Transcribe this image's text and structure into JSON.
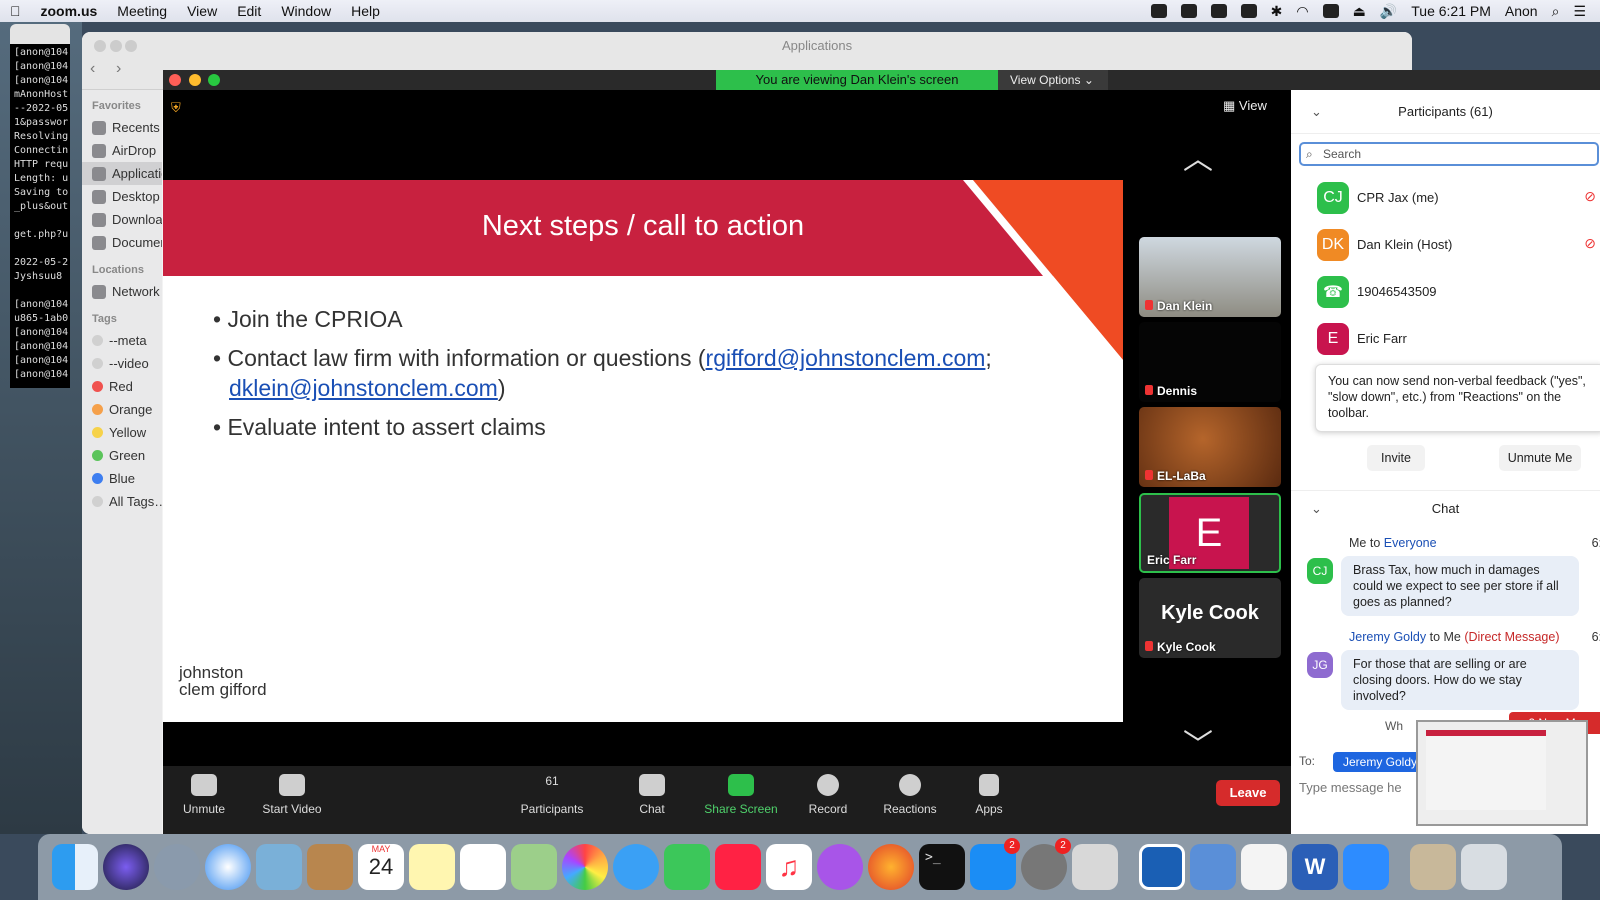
{
  "menubar": {
    "app": "zoom.us",
    "items": [
      "Meeting",
      "View",
      "Edit",
      "Window",
      "Help"
    ],
    "clock": "Tue 6:21 PM",
    "user": "Anon"
  },
  "terminal": {
    "lines": [
      "[anon@104",
      "[anon@104",
      "[anon@104",
      "mAnonHost",
      "--2022-05",
      "1&passwor",
      "Resolving",
      "Connectin",
      "HTTP requ",
      "Length: u",
      "Saving to",
      "_plus&out",
      "",
      "get.php?u",
      "",
      "2022-05-2",
      "Jyshsuu8",
      "",
      "[anon@104",
      "u865-1ab0",
      "[anon@104",
      "[anon@104",
      "[anon@104",
      "[anon@104"
    ]
  },
  "finder": {
    "title": "Applications",
    "favorites_header": "Favorites",
    "favorites": [
      "Recents",
      "AirDrop",
      "Applications",
      "Desktop",
      "Downloads",
      "Documents"
    ],
    "locations_header": "Locations",
    "locations": [
      "Network"
    ],
    "tags_header": "Tags",
    "tags": [
      {
        "label": "--meta",
        "color": "#d0d0d0"
      },
      {
        "label": "--video",
        "color": "#d0d0d0"
      },
      {
        "label": "Red",
        "color": "#f0524f"
      },
      {
        "label": "Orange",
        "color": "#f5a04a"
      },
      {
        "label": "Yellow",
        "color": "#f6d24a"
      },
      {
        "label": "Green",
        "color": "#5bc45b"
      },
      {
        "label": "Blue",
        "color": "#3d7ef0"
      },
      {
        "label": "All Tags…",
        "color": "#d0d0d0"
      }
    ]
  },
  "zoom": {
    "banner": "You are viewing Dan Klein's screen",
    "view_options": "View Options ⌄",
    "view_button": "View",
    "slide": {
      "title": "Next steps / call to action",
      "bullets": [
        "Join the CPRIOA",
        "Contact law firm with information or questions (",
        "Evaluate intent to assert claims"
      ],
      "email1": "rgifford@johnstonclem.com",
      "sep": ";",
      "email2": "dklein@johnstonclem.com",
      "close_paren": ")",
      "logo_line1": "johnston",
      "logo_line2": "clem gifford"
    },
    "thumbnails": [
      {
        "name": "Dan Klein"
      },
      {
        "name": "Dennis"
      },
      {
        "name": "EL-LaBa"
      },
      {
        "name": "Eric Farr",
        "initial": "E"
      },
      {
        "name": "Kyle Cook",
        "big": "Kyle Cook"
      }
    ],
    "toolbar": {
      "unmute": "Unmute",
      "start_video": "Start Video",
      "participants": "Participants",
      "participants_count": "61",
      "chat": "Chat",
      "share_screen": "Share Screen",
      "record": "Record",
      "reactions": "Reactions",
      "apps": "Apps",
      "leave": "Leave"
    }
  },
  "panel": {
    "participants_title": "Participants (61)",
    "search_placeholder": "Search",
    "participants": [
      {
        "initials": "CJ",
        "name": "CPR Jax (me)",
        "color": "#2dbf4b"
      },
      {
        "initials": "DK",
        "name": "Dan Klein (Host)",
        "color": "#f08a24"
      },
      {
        "initials": "☎",
        "name": "19046543509",
        "color": "#2dbf4b"
      },
      {
        "initials": "E",
        "name": "Eric Farr",
        "color": "#c8144e"
      }
    ],
    "tooltip": "You can now send non-verbal feedback (\"yes\", \"slow down\", etc.) from \"Reactions\" on the toolbar.",
    "invite": "Invite",
    "unmute_me": "Unmute Me",
    "chat_title": "Chat",
    "messages": [
      {
        "initials": "CJ",
        "color": "#2dbf4b",
        "from": "Me",
        "to_word": "to",
        "target": "Everyone",
        "time": "6:1",
        "text": "Brass Tax, how much in damages could we expect to see per store if all goes as planned?"
      },
      {
        "initials": "JG",
        "color": "#8e6bd0",
        "from": "Jeremy Goldy",
        "to_word": "to Me",
        "target": "(Direct Message)",
        "time": "6:1",
        "text": "For those that are selling or are closing doors.  How do we stay involved?"
      }
    ],
    "new_messages": "↓ 2 New Mes",
    "wh": "Wh",
    "to_label": "To:",
    "to_value": "Jeremy Goldy",
    "type_placeholder": "Type message he"
  },
  "dock": {
    "calendar_month": "MAY",
    "calendar_day": "24",
    "badge_appstore": "2",
    "badge_settings": "2"
  }
}
